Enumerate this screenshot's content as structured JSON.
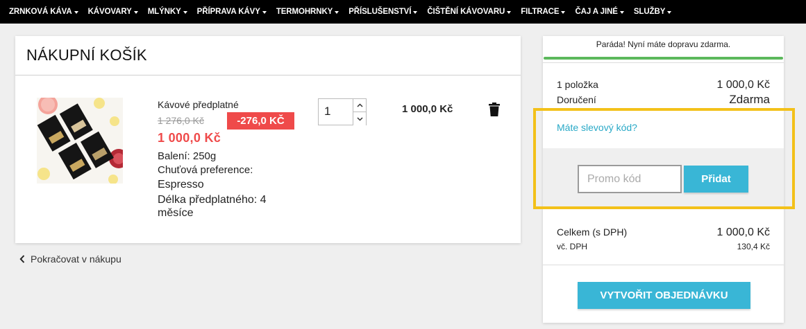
{
  "nav": {
    "items": [
      {
        "label": "ZRNKOVÁ KÁVA"
      },
      {
        "label": "KÁVOVARY"
      },
      {
        "label": "MLÝNKY"
      },
      {
        "label": "PŘÍPRAVA KÁVY"
      },
      {
        "label": "TERMOHRNKY"
      },
      {
        "label": "PŘÍSLUŠENSTVÍ"
      },
      {
        "label": "ČIŠTĚNÍ KÁVOVARU"
      },
      {
        "label": "FILTRACE"
      },
      {
        "label": "ČAJ A JINÉ"
      },
      {
        "label": "SLUŽBY"
      }
    ]
  },
  "cart": {
    "title": "NÁKUPNÍ KOŠÍK",
    "item": {
      "name": "Kávové předplatné",
      "old_price": "1 276,0 Kč",
      "discount": "-276,0 KČ",
      "new_price": "1 000,0 Kč",
      "attrs": {
        "packaging": "Balení: 250g",
        "taste_label": "Chuťová preference:",
        "taste_value": "Espresso",
        "length_line1": "Délka předplatného: 4",
        "length_line2": "měsíce"
      },
      "quantity": "1",
      "line_total": "1 000,0 Kč"
    },
    "continue_label": "Pokračovat v nákupu"
  },
  "summary": {
    "free_shipping_msg": "Paráda! Nyní máte dopravu zdarma.",
    "free_shipping_progress": 1.0,
    "items_label": "1 položka",
    "items_value": "1 000,0 Kč",
    "delivery_label": "Doručení",
    "delivery_value": "Zdarma",
    "promo_link": "Máte slevový kód?",
    "promo_placeholder": "Promo kód",
    "promo_button": "Přidat",
    "total_label": "Celkem (s DPH)",
    "total_value": "1 000,0 Kč",
    "vat_label": "vč. DPH",
    "vat_value": "130,4 Kč",
    "order_button": "VYTVOŘIT OBJEDNÁVKU"
  },
  "colors": {
    "accent": "#39b6d6",
    "sale": "#ef4a4a",
    "progress": "#5cb85c",
    "highlight": "#f3c11a"
  }
}
